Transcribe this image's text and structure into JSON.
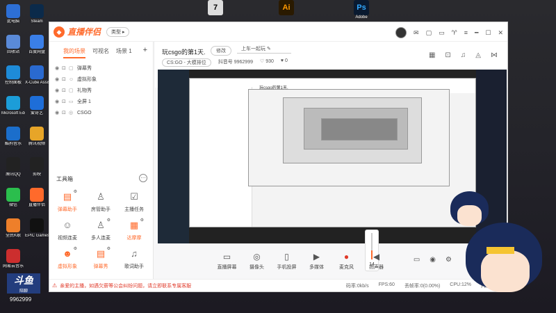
{
  "desktop_left": [
    {
      "label": "此电脑",
      "color": "#2d6fd6"
    },
    {
      "label": "回收站",
      "color": "#5a8ad8"
    },
    {
      "label": "控制面板",
      "color": "#1e8bd8"
    },
    {
      "label": "Microsoft Edge",
      "color": "#1c9dd8"
    },
    {
      "label": "酷狗音乐",
      "color": "#1b6ecb"
    },
    {
      "label": "腾讯QQ",
      "color": "#222"
    },
    {
      "label": "微信",
      "color": "#2bbe4d"
    },
    {
      "label": "全民K歌",
      "color": "#ee7f2a"
    },
    {
      "label": "网易云音乐",
      "color": "#cc2e2e"
    }
  ],
  "desktop_second": [
    {
      "label": "Steam",
      "color": "#0b2a4a"
    },
    {
      "label": "百度网盘",
      "color": "#3a7fe8"
    },
    {
      "label": "X-Cube Assistant",
      "color": "#2a6ad0"
    },
    {
      "label": "爱奇艺",
      "color": "#1e6ed8"
    },
    {
      "label": "腾讯视频",
      "color": "#e7a528"
    },
    {
      "label": "剪映",
      "color": "#222"
    },
    {
      "label": "直播伴侣",
      "color": "#ff6a2b"
    },
    {
      "label": "EPIC Games Launcher",
      "color": "#111"
    }
  ],
  "top_apps": [
    {
      "label": "",
      "text": "7",
      "bg": "#ddd",
      "fg": "#000"
    },
    {
      "label": "",
      "text": "Ai",
      "bg": "#2a1a00",
      "fg": "#ff9a00"
    },
    {
      "label": "Adobe",
      "text": "Ps",
      "bg": "#0a1a30",
      "fg": "#31a8ff"
    }
  ],
  "app": {
    "brand": "直播伴侣",
    "type_button": "类型",
    "window_controls": [
      "━",
      "☐",
      "✕"
    ]
  },
  "left_panel": {
    "tabs": [
      "我的场景",
      "可视名",
      "场景 1"
    ],
    "active_tab": 0,
    "scenes": [
      {
        "name": "弹幕秀",
        "kind": "▢"
      },
      {
        "name": "虚拟形象",
        "kind": "☺"
      },
      {
        "name": "礼物秀",
        "kind": "▢"
      },
      {
        "name": "全屏 1",
        "kind": "▭"
      },
      {
        "name": "CSGO",
        "kind": "◎"
      }
    ],
    "toolbox_title": "工具箱",
    "tools": [
      {
        "label": "弹幕助手",
        "icon": "▤",
        "orange": true,
        "gear": true
      },
      {
        "label": "房管助手",
        "icon": "♙",
        "orange": false,
        "gear": false
      },
      {
        "label": "主播任务",
        "icon": "☑",
        "orange": false,
        "gear": false
      },
      {
        "label": "视频连麦",
        "icon": "☺",
        "orange": false,
        "gear": false
      },
      {
        "label": "多人连麦",
        "icon": "♙",
        "orange": false,
        "gear": true
      },
      {
        "label": "达摩摩",
        "icon": "▦",
        "orange": true,
        "gear": true
      },
      {
        "label": "虚拟形象",
        "icon": "☻",
        "orange": true,
        "gear": true
      },
      {
        "label": "弹幕秀",
        "icon": "▤",
        "orange": true,
        "gear": true
      },
      {
        "label": "歌词助手",
        "icon": "♫",
        "orange": false,
        "gear": false
      }
    ]
  },
  "header": {
    "room_title": "玩csgo的第1天.",
    "modify_button": "修改",
    "title_input": "上车一起玩",
    "category": "CS:GO - 大模排位",
    "host_id_label": "抖音号",
    "host_id": "9962999",
    "fans": "930",
    "likes": "0"
  },
  "volume": {
    "value": "14",
    "fraction": 0.35
  },
  "bottom_tools": [
    {
      "label": "直播屏幕",
      "icon": "▭",
      "red": false
    },
    {
      "label": "摄像头",
      "icon": "◎",
      "red": false
    },
    {
      "label": "手机投屏",
      "icon": "▯",
      "red": false
    },
    {
      "label": "多媒体",
      "icon": "▶",
      "red": false
    },
    {
      "label": "麦克风",
      "icon": "●",
      "red": true
    },
    {
      "label": "扬声器",
      "icon": "◀",
      "red": false
    }
  ],
  "bottom_right_icons": [
    "▭",
    "◉",
    "⚙"
  ],
  "notice": {
    "message": "亲爱的主播，如遇欠薪等公会纠纷问题，请立即联系专属客服",
    "bitrate": "码率:0kb/s",
    "fps": "FPS:60",
    "drop": "丢帧率:0(0.00%)",
    "cpu": "CPU:12%",
    "mem": "内存:44%"
  },
  "overlay": {
    "logo_big": "斗鱼",
    "logo_small": "陪聊",
    "room_number": "9962999"
  }
}
